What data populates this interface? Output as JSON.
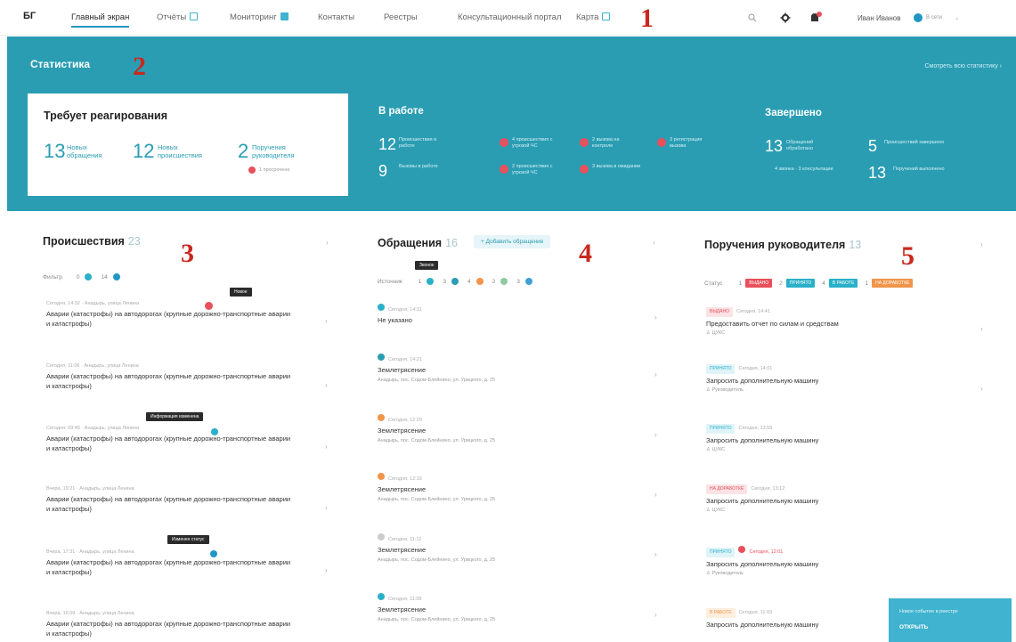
{
  "topbar": {
    "logo": "БГ",
    "nav": [
      {
        "label": "Главный экран",
        "active": true
      },
      {
        "label": "Отчёты",
        "icon": "report-icon"
      },
      {
        "label": "Мониторинг",
        "icon": "monitor-icon"
      },
      {
        "label": "Контакты"
      },
      {
        "label": "Реестры"
      },
      {
        "label": "Консультационный портал"
      },
      {
        "label": "Карта",
        "icon": "map-icon"
      }
    ],
    "user_name": "Иван Иванов",
    "user_status": "В сети"
  },
  "markers": [
    "1",
    "2",
    "3",
    "4",
    "5"
  ],
  "stats": {
    "title": "Статистика",
    "link": "Смотреть всю статистику",
    "react_title": "Требует реагирования",
    "react": [
      {
        "num": "13",
        "label": "Новых обращения"
      },
      {
        "num": "12",
        "label": "Новых происшествия"
      },
      {
        "num": "2",
        "label": "Поручения руководителя"
      }
    ],
    "react_overdue": "1 просрочено",
    "work_title": "В работе",
    "work": [
      {
        "num": "12",
        "label": "Происшествия в работе"
      },
      {
        "num": "9",
        "label": "Вызовы в работе"
      }
    ],
    "work_tags": [
      "4 происшествия с угрозой ЧС",
      "2 вызова на контроле",
      "3 регистрация вызова",
      "2 происшествия с угрозой ЧС",
      "3 вызова в ожидании"
    ],
    "done_title": "Завершено",
    "done": [
      {
        "num": "13",
        "label": "Обращений обработано"
      },
      {
        "num": "5",
        "label": "Происшествий завершено"
      },
      {
        "num": "13",
        "label": "Поручений выполнено"
      }
    ],
    "done_sub": "4 звонка · 3 консультации"
  },
  "incidents": {
    "title": "Происшествия",
    "count": "23",
    "filter_label": "Фильтр",
    "filter_counts": [
      "0",
      "14"
    ],
    "items": [
      {
        "meta": "Сегодня, 14:32 · Анадырь, улица Ленина",
        "text": "Аварии (катастрофы) на автодорогах (крупные дорожно-транспортные аварии и катастрофы)",
        "tip": "Новое"
      },
      {
        "meta": "Сегодня, 11:06 · Анадырь, улица Ленина",
        "text": "Аварии (катастрофы) на автодорогах (крупные дорожно-транспортные аварии и катастрофы)"
      },
      {
        "meta": "Сегодня, 09:45 · Анадырь, улица Ленина",
        "text": "Аварии (катастрофы) на автодорогах (крупные дорожно-транспортные аварии и катастрофы)",
        "tip": "Информация изменена"
      },
      {
        "meta": "Вчера, 19:21 · Анадырь, улица Ленина",
        "text": "Аварии (катастрофы) на автодорогах (крупные дорожно-транспортные аварии и катастрофы)"
      },
      {
        "meta": "Вчера, 17:31 · Анадырь, улица Ленина",
        "text": "Аварии (катастрофы) на автодорогах (крупные дорожно-транспортные аварии и катастрофы)",
        "tip": "Изменен статус"
      },
      {
        "meta": "Вчера, 16:09 · Анадырь, улица Ленина",
        "text": "Аварии (катастрофы) на автодорогах (крупные дорожно-транспортные аварии и катастрофы)"
      }
    ]
  },
  "requests": {
    "title": "Обращения",
    "count": "16",
    "add_button": "+ Добавить обращение",
    "filter_label": "Источник",
    "filter_counts": [
      "1",
      "3",
      "4",
      "2",
      "3"
    ],
    "filter_tip": "Звонок",
    "items": [
      {
        "meta": "Сегодня, 14:31",
        "text": "Не указано",
        "loc": ""
      },
      {
        "meta": "Сегодня, 14:21",
        "text": "Землетрясение",
        "loc": "Анадырь, пос. Содом-Блейнино, ул. Урицкого, д. 25"
      },
      {
        "meta": "Сегодня, 12:29",
        "text": "Землетрясение",
        "loc": "Анадырь, пос. Содом-Блейнино, ул. Урицкого, д. 25"
      },
      {
        "meta": "Сегодня, 12:16",
        "text": "Землетрясение",
        "loc": "Анадырь, пос. Содом-Блейнино, ул. Урицкого, д. 25"
      },
      {
        "meta": "Сегодня, 11:12",
        "text": "Землетрясение",
        "loc": "Анадырь, пос. Содом-Блейнино, ул. Урицкого, д. 25"
      },
      {
        "meta": "Сегодня, 11:09",
        "text": "Землетрясение",
        "loc": "Анадырь, пос. Содом-Блейнино, ул. Урицкого, д. 25"
      }
    ]
  },
  "orders": {
    "title": "Поручения руководителя",
    "count": "13",
    "filter_label": "Статус",
    "filter": [
      {
        "count": "1",
        "label": "ВЫДАНО",
        "color": "#e8505b"
      },
      {
        "count": "2",
        "label": "ПРИНЯТО",
        "color": "#2ab0c9"
      },
      {
        "count": "4",
        "label": "В РАБОТЕ",
        "color": "#2ab0c9"
      },
      {
        "count": "1",
        "label": "НА ДОРАБОТКЕ",
        "color": "#f0954a"
      }
    ],
    "items": [
      {
        "status": "ВЫДАНО",
        "status_color": "#e8505b",
        "meta": "Сегодня, 14:41",
        "text": "Предоставить отчет по силам и средствам",
        "owner": "ЦУКС"
      },
      {
        "status": "ПРИНЯТО",
        "status_color": "#2ab0c9",
        "meta": "Сегодня, 14:01",
        "text": "Запросить дополнительную машину",
        "owner": "Руководитель"
      },
      {
        "status": "ПРИНЯТО",
        "status_color": "#2ab0c9",
        "meta": "Сегодня, 13:59",
        "text": "Запросить дополнительную машину",
        "owner": "ЦУКС"
      },
      {
        "status": "НА ДОРАБОТКЕ",
        "status_color": "#f0954a",
        "meta": "Сегодня, 13:12",
        "text": "Запросить дополнительную машину",
        "owner": "ЦУКС"
      },
      {
        "status": "ПРИНЯТО",
        "status_color": "#2ab0c9",
        "meta": "Сегодня, 12:01",
        "text": "Запросить дополнительную машину",
        "owner": "Руководитель"
      },
      {
        "status": "В РАБОТЕ",
        "status_color": "#f0954a",
        "meta": "Сегодня, 11:03",
        "text": "Запросить дополнительную машину",
        "owner": "ЦУКС"
      }
    ]
  },
  "float_button": {
    "text": "Новое событие в реестре",
    "action": "ОТКРЫТЬ"
  },
  "colors": {
    "accent": "#2a9db3",
    "red": "#e8505b",
    "orange": "#f0954a",
    "marker": "#c9281f"
  }
}
